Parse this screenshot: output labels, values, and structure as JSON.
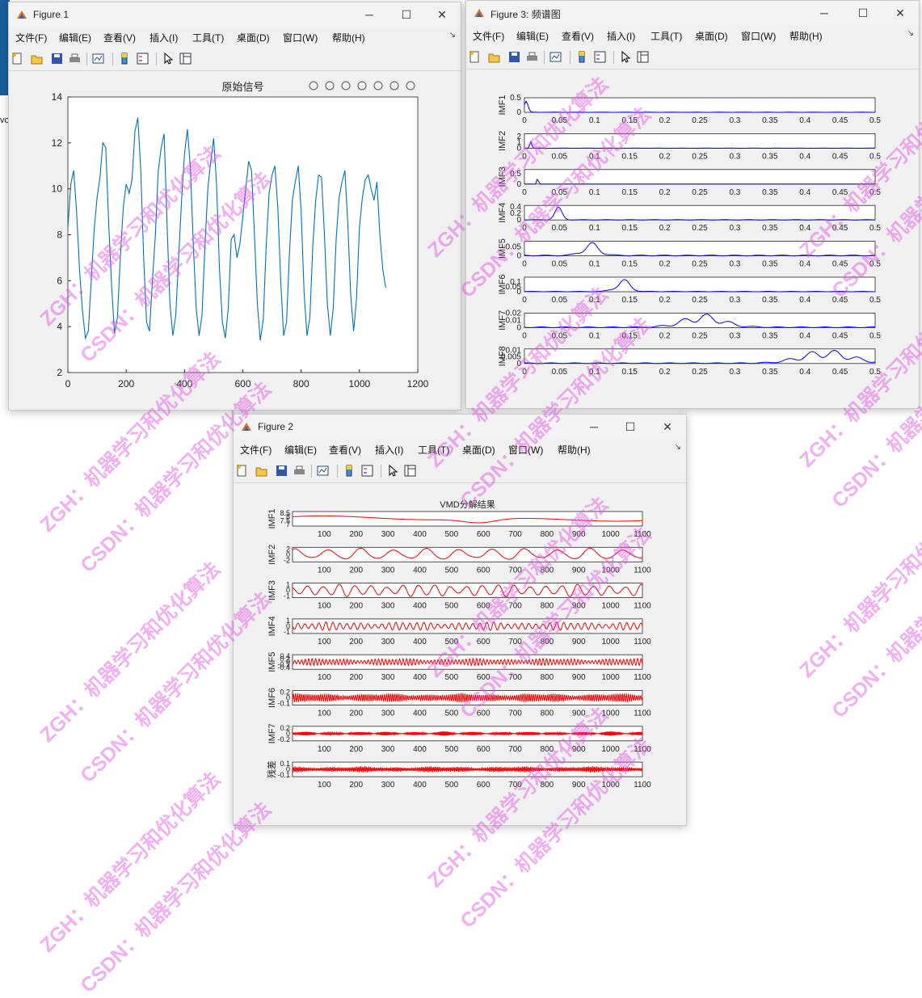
{
  "desktop": {
    "partial_text": "vo"
  },
  "window_figure1": {
    "title": "Figure 1",
    "menu": [
      "文件(F)",
      "编辑(E)",
      "查看(V)",
      "插入(I)",
      "工具(T)",
      "桌面(D)",
      "窗口(W)",
      "帮助(H)"
    ],
    "window_controls": {
      "minimize": "─",
      "maximize": "☐",
      "close": "✕"
    },
    "axes_toolbar_icons": [
      "brush-icon",
      "data-tip-icon",
      "rotate-icon",
      "pan-icon",
      "zoom-in-icon",
      "zoom-out-icon",
      "home-icon"
    ]
  },
  "window_figure3": {
    "title": "Figure 3: 频谱图",
    "menu": [
      "文件(F)",
      "编辑(E)",
      "查看(V)",
      "插入(I)",
      "工具(T)",
      "桌面(D)",
      "窗口(W)",
      "帮助(H)"
    ],
    "window_controls": {
      "minimize": "─",
      "maximize": "☐",
      "close": "✕"
    }
  },
  "window_figure2": {
    "title": "Figure 2",
    "menu": [
      "文件(F)",
      "编辑(E)",
      "查看(V)",
      "插入(I)",
      "工具(T)",
      "桌面(D)",
      "窗口(W)",
      "帮助(H)"
    ],
    "window_controls": {
      "minimize": "─",
      "maximize": "☐",
      "close": "✕"
    }
  },
  "toolbar_icons": [
    "new-file-icon",
    "open-folder-icon",
    "save-icon",
    "print-icon",
    "link-plot-icon",
    "colorbar-icon",
    "legend-icon",
    "pointer-icon",
    "property-inspector-icon"
  ],
  "watermark_texts": [
    "ZGH：机器学习和优化算法",
    "CSDN：机器学习和优化算法"
  ],
  "colors": {
    "signal_line": "#0072bd",
    "spectrum_line": "#0000ff",
    "imf_line": "#ff0000",
    "watermark": "#e050e0",
    "axes_bg": "#ffffff",
    "figure_bg": "#f0f0f0"
  },
  "chart_data": [
    {
      "type": "line",
      "title": "原始信号",
      "xlabel": "",
      "ylabel": "",
      "xlim": [
        0,
        1200
      ],
      "ylim": [
        2,
        14
      ],
      "xticks": [
        0,
        200,
        400,
        600,
        800,
        1000,
        1200
      ],
      "yticks": [
        2,
        4,
        6,
        8,
        10,
        12,
        14
      ],
      "series": [
        {
          "x": [
            0,
            10,
            20,
            30,
            40,
            50,
            60,
            70,
            80,
            90,
            100,
            110,
            120,
            130,
            140,
            150,
            160,
            170,
            180,
            190,
            200,
            210,
            220,
            230,
            240,
            250,
            260,
            270,
            280,
            290,
            300,
            310,
            320,
            330,
            340,
            350,
            360,
            370,
            380,
            390,
            400,
            410,
            420,
            430,
            440,
            450,
            460,
            470,
            480,
            490,
            500,
            510,
            520,
            530,
            540,
            550,
            560,
            570,
            580,
            590,
            600,
            610,
            620,
            630,
            640,
            650,
            660,
            670,
            680,
            690,
            700,
            710,
            720,
            730,
            740,
            750,
            760,
            770,
            780,
            790,
            800,
            810,
            820,
            830,
            840,
            850,
            860,
            870,
            880,
            890,
            900,
            910,
            920,
            930,
            940,
            950,
            960,
            970,
            980,
            990,
            1000,
            1010,
            1020,
            1030,
            1040,
            1050,
            1060,
            1070,
            1080,
            1090
          ],
          "values": [
            8.3,
            10.2,
            10.8,
            9.0,
            6.5,
            4.7,
            3.5,
            3.8,
            6.0,
            8.2,
            9.6,
            10.5,
            12.0,
            11.8,
            8.5,
            5.8,
            3.7,
            4.4,
            7.0,
            9.2,
            10.2,
            9.8,
            10.4,
            12.5,
            13.1,
            10.8,
            7.0,
            4.2,
            3.8,
            6.0,
            8.0,
            10.8,
            11.8,
            12.4,
            8.5,
            5.0,
            3.6,
            4.5,
            7.0,
            9.5,
            11.5,
            12.6,
            11.0,
            7.6,
            4.8,
            3.6,
            4.5,
            7.5,
            10.0,
            11.2,
            12.2,
            10.2,
            6.5,
            4.2,
            3.5,
            4.8,
            7.8,
            8.0,
            7.0,
            7.6,
            8.8,
            10.0,
            11.2,
            10.8,
            8.0,
            5.0,
            3.4,
            4.3,
            7.5,
            9.8,
            10.6,
            11.0,
            9.2,
            6.0,
            3.6,
            4.2,
            7.2,
            9.5,
            10.3,
            11.0,
            9.0,
            5.5,
            3.6,
            4.4,
            7.5,
            9.5,
            10.6,
            10.5,
            8.0,
            5.0,
            3.6,
            4.8,
            7.8,
            9.6,
            10.3,
            10.8,
            8.5,
            5.4,
            3.8,
            5.2,
            8.3,
            9.6,
            10.4,
            10.6,
            10.0,
            9.5,
            10.3,
            8.0,
            6.5,
            5.7
          ]
        }
      ]
    },
    {
      "type": "line",
      "title": "频谱图",
      "xlim": [
        0,
        0.5
      ],
      "xticks": [
        0,
        0.05,
        0.1,
        0.15,
        0.2,
        0.25,
        0.3,
        0.35,
        0.4,
        0.45,
        0.5
      ],
      "panels": [
        {
          "name": "IMF1",
          "ylim": [
            0,
            0.5
          ],
          "yticks": [
            0,
            0.5
          ],
          "peak_at": 0.002,
          "peak": 0.45,
          "spread": 0.004,
          "noise": 0.005
        },
        {
          "name": "IMF2",
          "ylim": [
            0,
            2.5
          ],
          "yticks": [
            0,
            1,
            2
          ],
          "peak_at": 0.009,
          "peak": 2.2,
          "spread": 0.002,
          "noise": 0.01
        },
        {
          "name": "IMF3",
          "ylim": [
            0,
            0.7
          ],
          "yticks": [
            0,
            0.5
          ],
          "peak_at": 0.019,
          "peak": 0.65,
          "spread": 0.0015,
          "noise": 0.005
        },
        {
          "name": "IMF4",
          "ylim": [
            0,
            0.45
          ],
          "yticks": [
            0,
            0.2,
            0.4
          ],
          "peak_at": 0.048,
          "peak": 0.4,
          "spread": 0.008,
          "noise": 0.01
        },
        {
          "name": "IMF5",
          "ylim": [
            0,
            0.08
          ],
          "yticks": [
            0,
            0.05
          ],
          "peak_at": 0.095,
          "peak": 0.07,
          "spread": 0.018,
          "noise": 0.004
        },
        {
          "name": "IMF6",
          "ylim": [
            0,
            0.15
          ],
          "yticks": [
            0,
            0.05,
            0.1
          ],
          "peak_at": 0.14,
          "peak": 0.13,
          "spread": 0.015,
          "noise": 0.004
        },
        {
          "name": "IMF7",
          "ylim": [
            0,
            0.02
          ],
          "yticks": [
            0,
            0.01,
            0.02
          ],
          "peak_at": 0.255,
          "peak": 0.018,
          "spread": 0.04,
          "noise": 0.001
        },
        {
          "name": "IMF8",
          "ylim": [
            0,
            0.011
          ],
          "yticks": [
            0,
            0.005,
            0.01
          ],
          "peak_at": 0.43,
          "peak": 0.01,
          "spread": 0.05,
          "noise": 0.0005
        }
      ]
    },
    {
      "type": "line",
      "title": "VMD分解结果",
      "xlim": [
        0,
        1100
      ],
      "xticks": [
        100,
        200,
        300,
        400,
        500,
        600,
        700,
        800,
        900,
        1000,
        1100
      ],
      "panels": [
        {
          "name": "IMF1",
          "ytick_labels": [
            "8.5",
            "8",
            "7.5",
            "7"
          ],
          "kind": "trend"
        },
        {
          "name": "IMF2",
          "ytick_labels": [
            "2",
            "0",
            "-2"
          ],
          "period": 103,
          "amp": 0.9
        },
        {
          "name": "IMF3",
          "ytick_labels": [
            "1",
            "0",
            "-1"
          ],
          "period": 50,
          "amp": 0.9
        },
        {
          "name": "IMF4",
          "ytick_labels": [
            "1",
            "0",
            "-1"
          ],
          "period": 22,
          "amp": 0.6
        },
        {
          "name": "IMF5",
          "ytick_labels": [
            "0.4",
            "0.2",
            "0",
            "-0.2",
            "-0.4"
          ],
          "period": 11,
          "amp": 0.5
        },
        {
          "name": "IMF6",
          "ytick_labels": [
            "0.2",
            "0",
            "-0.1"
          ],
          "period": 6.5,
          "amp": 0.65
        },
        {
          "name": "IMF7",
          "ytick_labels": [
            "0.2",
            "0",
            "-0.2"
          ],
          "period": 3.2,
          "amp": 0.3
        },
        {
          "name": "残差",
          "ytick_labels": [
            "0.1",
            "0",
            "-0.1"
          ],
          "period": 2.5,
          "amp": 0.45
        }
      ]
    }
  ]
}
